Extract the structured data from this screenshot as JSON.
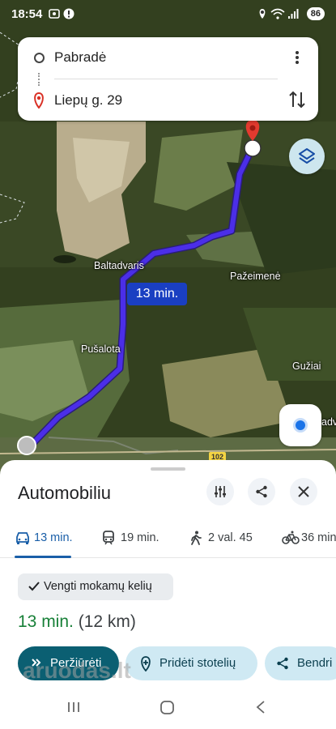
{
  "status_bar": {
    "time": "18:54",
    "battery": "86"
  },
  "route_input": {
    "origin": "Pabradė",
    "destination": "Liepų g. 29"
  },
  "map": {
    "labels": [
      "Baltadvaris",
      "Pažeimenė",
      "Pušalota",
      "Gužiai",
      "adv"
    ],
    "route_time_badge": "13 min.",
    "road_number": "102"
  },
  "sheet": {
    "title": "Automobiliu",
    "tabs": [
      {
        "mode": "car-icon",
        "label": "13 min.",
        "active": true
      },
      {
        "mode": "train-icon",
        "label": "19 min."
      },
      {
        "mode": "walk-icon",
        "label": "2 val. 45"
      },
      {
        "mode": "bike-icon",
        "label": "36 min"
      }
    ],
    "option_chip": "Vengti mokamų kelių",
    "summary_duration": "13 min.",
    "summary_distance": "(12 km)",
    "actions": {
      "preview": "Peržiūrėti",
      "add_stops": "Pridėti stotelių",
      "share": "Bendri"
    }
  },
  "watermark": "aruodas.lt",
  "colors": {
    "route": "#4b2ee8",
    "accent_blue": "#1a5fa8",
    "green_time": "#188038",
    "primary_button": "#0b5f72",
    "secondary_button": "#cfe9f3"
  }
}
